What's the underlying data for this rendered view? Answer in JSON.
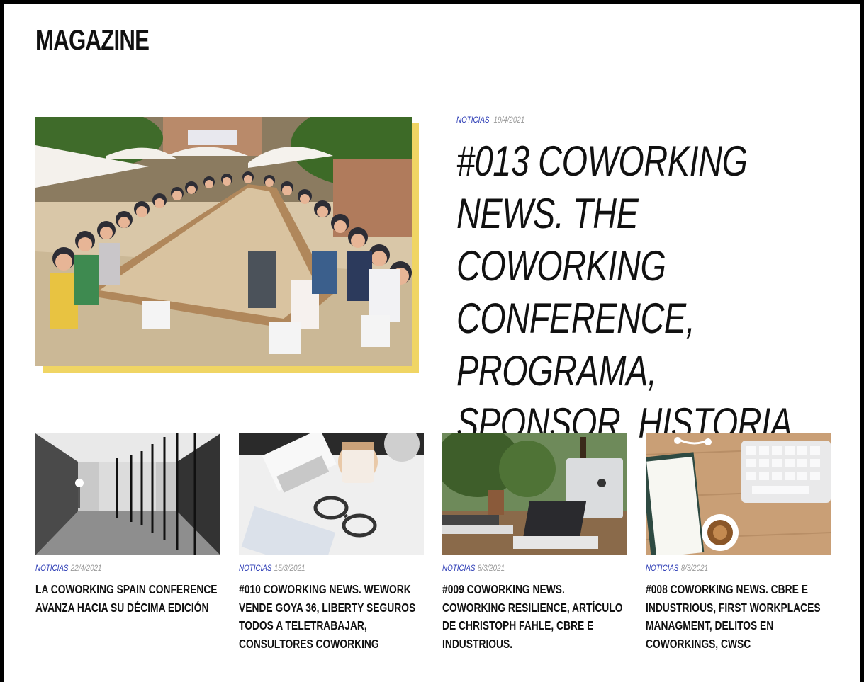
{
  "section": {
    "title": "MAGAZINE"
  },
  "featured": {
    "category": "NOTICIAS",
    "date": "19/4/2021",
    "title": "#013 COWORKING NEWS. THE COWORKING CONFERENCE, PROGRAMA, SPONSOR, HISTORIA",
    "image": "conference-group-photo",
    "shadow_color": "#f0d564"
  },
  "cards": [
    {
      "category": "NOTICIAS",
      "date": "22/4/2021",
      "title": "LA COWORKING SPAIN CONFERENCE AVANZA HACIA SU DÉCIMA EDICIÓN",
      "image": "office-corridor-photo"
    },
    {
      "category": "NOTICIAS",
      "date": "15/3/2021",
      "title": "#010 COWORKING NEWS. WEWORK VENDE GOYA 36, LIBERTY SEGUROS TODOS A TELETRABAJAR, CONSULTORES COWORKING",
      "image": "desk-glasses-photo"
    },
    {
      "category": "NOTICIAS",
      "date": "8/3/2021",
      "title": "#009 COWORKING NEWS. COWORKING RESILIENCE, ARTÍCULO DE CHRISTOPH FAHLE, CBRE E INDUSTRIOUS.",
      "image": "workspace-laptop-photo"
    },
    {
      "category": "NOTICIAS",
      "date": "8/3/2021",
      "title": "#008 COWORKING NEWS. CBRE E INDUSTRIOUS, FIRST WORKPLACES MANAGMENT, DELITOS EN COWORKINGS, CWSC",
      "image": "keyboard-coffee-photo"
    }
  ],
  "colors": {
    "category": "#2b3bb5",
    "date": "#9a9a9a",
    "text": "#111111"
  }
}
